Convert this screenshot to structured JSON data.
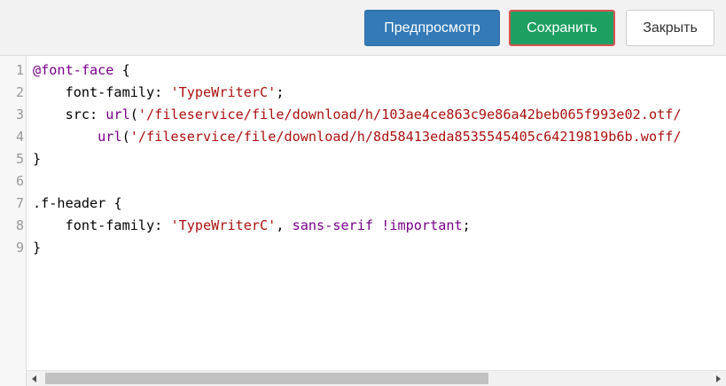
{
  "toolbar": {
    "preview_label": "Предпросмотр",
    "save_label": "Сохранить",
    "close_label": "Закрыть"
  },
  "editor": {
    "line_numbers": [
      "1",
      "2",
      "3",
      "4",
      "5",
      "6",
      "7",
      "8",
      "9"
    ],
    "lines": [
      [
        {
          "t": "def",
          "v": "@font-face"
        },
        {
          "t": "punc",
          "v": " {"
        }
      ],
      [
        {
          "t": "prop",
          "v": "    font-family: "
        },
        {
          "t": "str",
          "v": "'TypeWriterC'"
        },
        {
          "t": "punc",
          "v": ";"
        }
      ],
      [
        {
          "t": "prop",
          "v": "    src: "
        },
        {
          "t": "kw",
          "v": "url"
        },
        {
          "t": "punc",
          "v": "("
        },
        {
          "t": "str",
          "v": "'/fileservice/file/download/h/103ae4ce863c9e86a42beb065f993e02.otf/"
        }
      ],
      [
        {
          "t": "prop",
          "v": "        "
        },
        {
          "t": "kw",
          "v": "url"
        },
        {
          "t": "punc",
          "v": "("
        },
        {
          "t": "str",
          "v": "'/fileservice/file/download/h/8d58413eda8535545405c64219819b6b.woff/"
        }
      ],
      [
        {
          "t": "punc",
          "v": "}"
        }
      ],
      [],
      [
        {
          "t": "tag",
          "v": ".f-header"
        },
        {
          "t": "punc",
          "v": " {"
        }
      ],
      [
        {
          "t": "prop",
          "v": "    font-family: "
        },
        {
          "t": "str",
          "v": "'TypeWriterC'"
        },
        {
          "t": "punc",
          "v": ", "
        },
        {
          "t": "kw",
          "v": "sans-serif"
        },
        {
          "t": "punc",
          "v": " "
        },
        {
          "t": "kw",
          "v": "!important"
        },
        {
          "t": "punc",
          "v": ";"
        }
      ],
      [
        {
          "t": "punc",
          "v": "}"
        }
      ]
    ]
  },
  "scrollbar": {
    "left_arrow_icon": "arrow-left-icon",
    "right_arrow_icon": "arrow-right-icon"
  },
  "colors": {
    "preview_button": "#337ab7",
    "save_button": "#1e9f62",
    "save_button_border": "#d9534f",
    "string": "#aa1111",
    "keyword": "#770088"
  }
}
